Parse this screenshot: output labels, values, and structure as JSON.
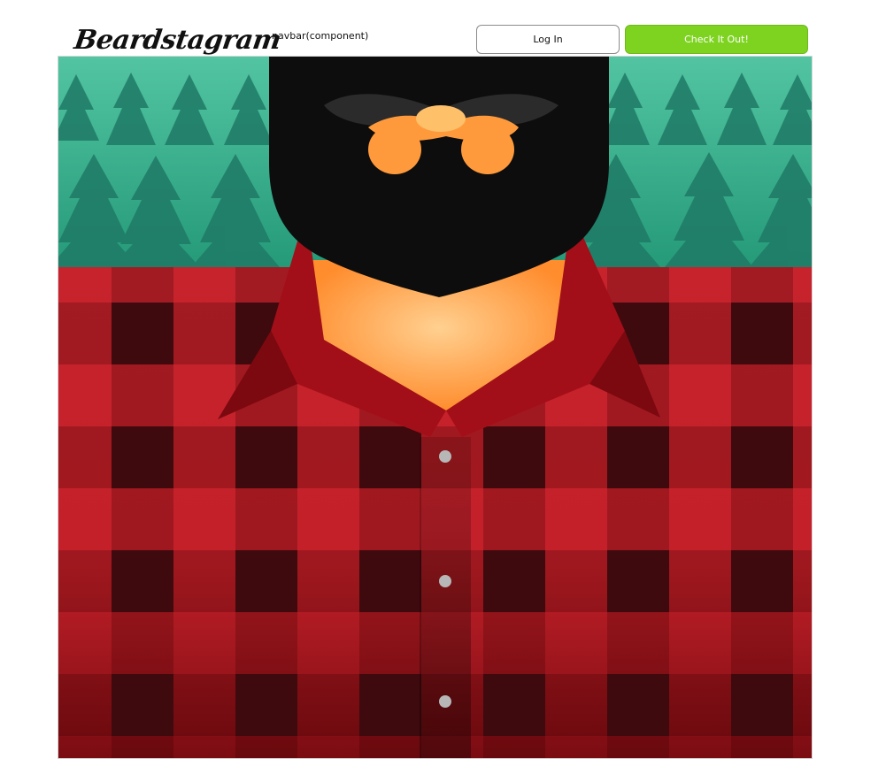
{
  "navbar": {
    "logo_text": "Beardstagram",
    "component_label": "navbar(component)",
    "login_label": "Log In",
    "cta_label": "Check It Out!"
  },
  "hero": {
    "image_subject": "bearded-lumberjack-illustration"
  },
  "colors": {
    "cta_green": "#7ed321",
    "sky_teal": "#2fa98a",
    "flannel_red": "#c4202a",
    "flannel_dark": "#3c0b0e",
    "beard_black": "#0d0d0d",
    "skin_orange": "#ff9a3c"
  }
}
